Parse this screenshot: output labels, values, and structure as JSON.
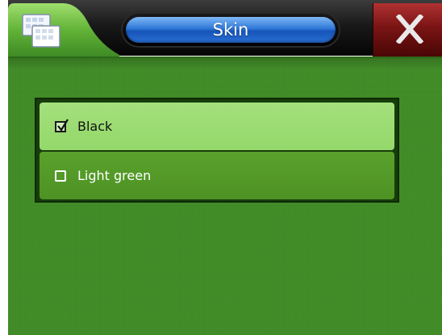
{
  "window": {
    "title": "Skin",
    "home_icon": "home-grid-icon",
    "close_icon": "close-x-icon"
  },
  "skin_options": [
    {
      "label": "Black",
      "checked": true
    },
    {
      "label": "Light green",
      "checked": false
    }
  ],
  "colors": {
    "panel_green": "#3f8a25",
    "selected_row": "#9ddc74",
    "unselected_row": "#529a28",
    "title_blue": "#2f78d8",
    "close_red": "#7a1414"
  }
}
